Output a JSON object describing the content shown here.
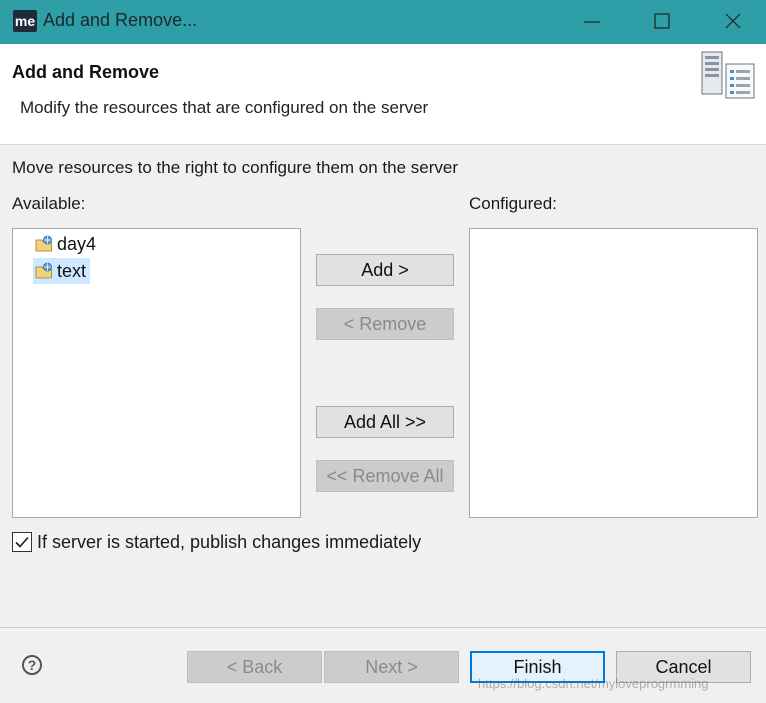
{
  "window": {
    "app_icon_text": "me",
    "title": "Add and Remove..."
  },
  "header": {
    "title": "Add and Remove",
    "description": "Modify the resources that are configured on the server"
  },
  "main": {
    "instruction": "Move resources to the right to configure them on the server",
    "available_label": "Available:",
    "configured_label": "Configured:",
    "available_items": [
      {
        "label": "day4",
        "selected": false
      },
      {
        "label": "text",
        "selected": true
      }
    ],
    "configured_items": [],
    "buttons": {
      "add": "Add >",
      "remove": "< Remove",
      "add_all": "Add All >>",
      "remove_all": "<< Remove All"
    },
    "publish_checkbox": {
      "label": "If server is started, publish changes immediately",
      "checked": true
    }
  },
  "footer": {
    "help_icon": "?",
    "back": "< Back",
    "next": "Next >",
    "finish": "Finish",
    "cancel": "Cancel"
  },
  "watermark": "https://blog.csdn.net/myloveprogrmming",
  "colors": {
    "titlebar": "#2e9fa6",
    "selection": "#cde8ff",
    "default_button_border": "#0078d7"
  }
}
